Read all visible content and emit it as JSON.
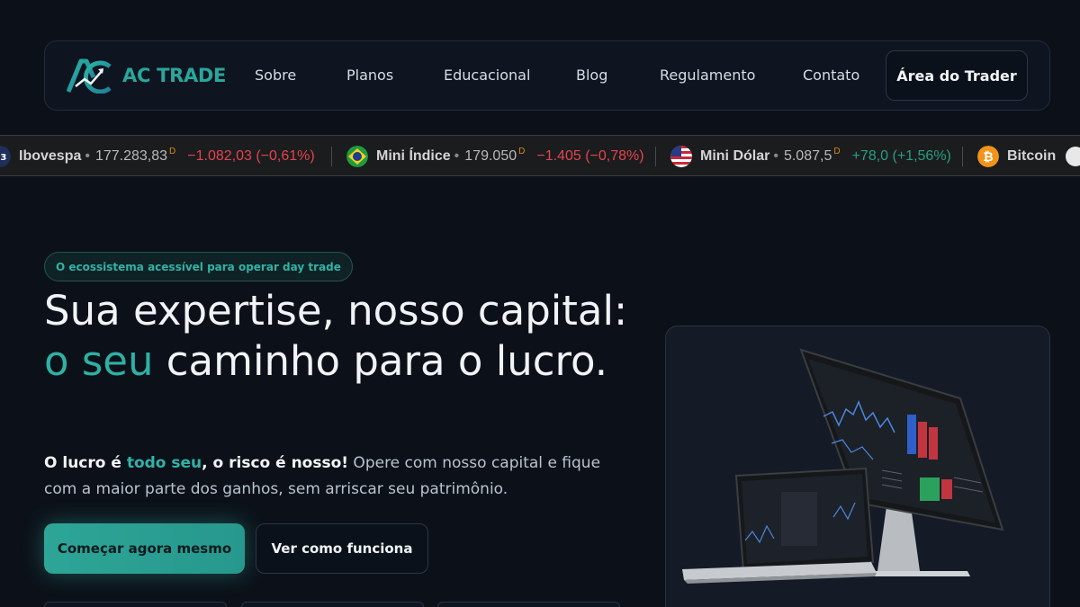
{
  "brand": {
    "name": "AC TRADE",
    "logo_icon": "ac-monogram-chart-logo",
    "accent": "#2aa69c"
  },
  "nav": {
    "items": [
      {
        "label": "Sobre"
      },
      {
        "label": "Planos"
      },
      {
        "label": "Educacional"
      },
      {
        "label": "Blog"
      },
      {
        "label": "Regulamento"
      },
      {
        "label": "Contato"
      }
    ],
    "cta": "Área do Trader"
  },
  "ticker": [
    {
      "name": "Ibovespa",
      "icon": "b3-logo",
      "sep": "•",
      "price": "177.283,83",
      "marker": "D",
      "change": "−1.082,03 (−0,61%)",
      "direction": "down"
    },
    {
      "name": "Mini Índice",
      "icon": "brazil-flag",
      "sep": "•",
      "price": "179.050",
      "marker": "D",
      "change": "−1.405 (−0,78%)",
      "direction": "down"
    },
    {
      "name": "Mini Dólar",
      "icon": "usa-flag",
      "sep": "•",
      "price": "5.087,5",
      "marker": "D",
      "change": "+78,0 (+1,56%)",
      "direction": "up"
    },
    {
      "name": "Bitcoin",
      "icon": "bitcoin-logo",
      "sep": "",
      "price": "",
      "marker": "",
      "change": "",
      "direction": ""
    }
  ],
  "hero": {
    "badge": "O ecossistema acessível para operar day trade",
    "title_part1": "Sua expertise, nosso capital: ",
    "title_accent": "o seu",
    "title_part2": " caminho para o lucro.",
    "sub_bold1": "O lucro é ",
    "sub_teal": "todo seu",
    "sub_bold2": ", o risco é nosso!",
    "sub_rest": " Opere com nosso capital e fique com a maior parte dos ganhos, sem arriscar seu patrimônio.",
    "primary_cta": "Começar agora mesmo",
    "secondary_cta": "Ver como funciona"
  },
  "preview": {
    "image": "trading-platform-desktop-and-laptop-mockup"
  },
  "colors": {
    "background": "#0c1119",
    "teal": "#2fb0a3",
    "negative": "#e2454d",
    "positive": "#26a07c",
    "marker": "#d98a1c"
  }
}
